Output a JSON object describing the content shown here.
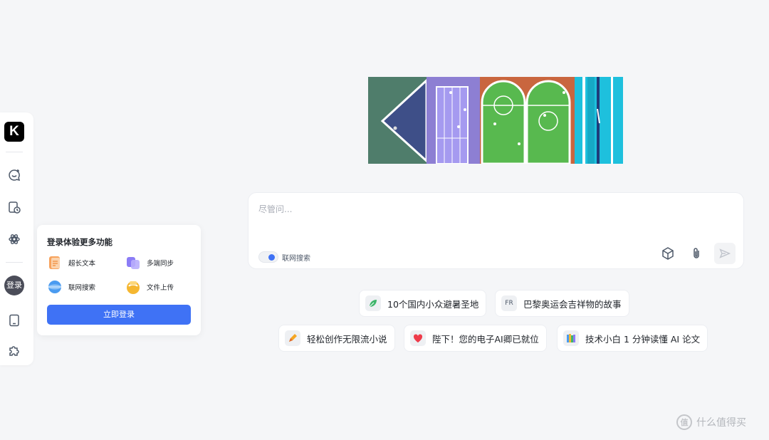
{
  "sidebar": {
    "logo_letter": "K",
    "icons": [
      "new-chat-icon",
      "history-icon",
      "discover-icon",
      "device-icon",
      "plugin-icon"
    ],
    "avatar_label": "登录"
  },
  "login_popover": {
    "title": "登录体验更多功能",
    "features": [
      {
        "label": "超长文本",
        "icon": "long-text-icon",
        "color": "#f7a25c"
      },
      {
        "label": "多端同步",
        "icon": "sync-icon",
        "color": "#8b7cf6"
      },
      {
        "label": "联网搜索",
        "icon": "web-search-icon",
        "color": "#4a9bf0"
      },
      {
        "label": "文件上传",
        "icon": "file-upload-icon",
        "color": "#f5b731"
      }
    ],
    "button_label": "立即登录"
  },
  "input": {
    "placeholder": "尽管问...",
    "web_search_label": "联网搜索"
  },
  "suggestions": [
    {
      "label": "10个国内小众避暑圣地",
      "icon": "leaf-icon",
      "icon_text": ""
    },
    {
      "label": "巴黎奥运会吉祥物的故事",
      "icon": "fr-badge-icon",
      "icon_text": "FR"
    },
    {
      "label": "轻松创作无限流小说",
      "icon": "pen-icon",
      "icon_text": ""
    },
    {
      "label": "陛下！您的电子AI卿已就位",
      "icon": "heart-icon",
      "icon_text": ""
    },
    {
      "label": "技术小白 1 分钟读懂 AI 论文",
      "icon": "books-icon",
      "icon_text": ""
    }
  ],
  "watermark": {
    "symbol": "值",
    "text": "什么值得买"
  },
  "colors": {
    "accent": "#3f72f5",
    "background": "#f5f6f8"
  }
}
